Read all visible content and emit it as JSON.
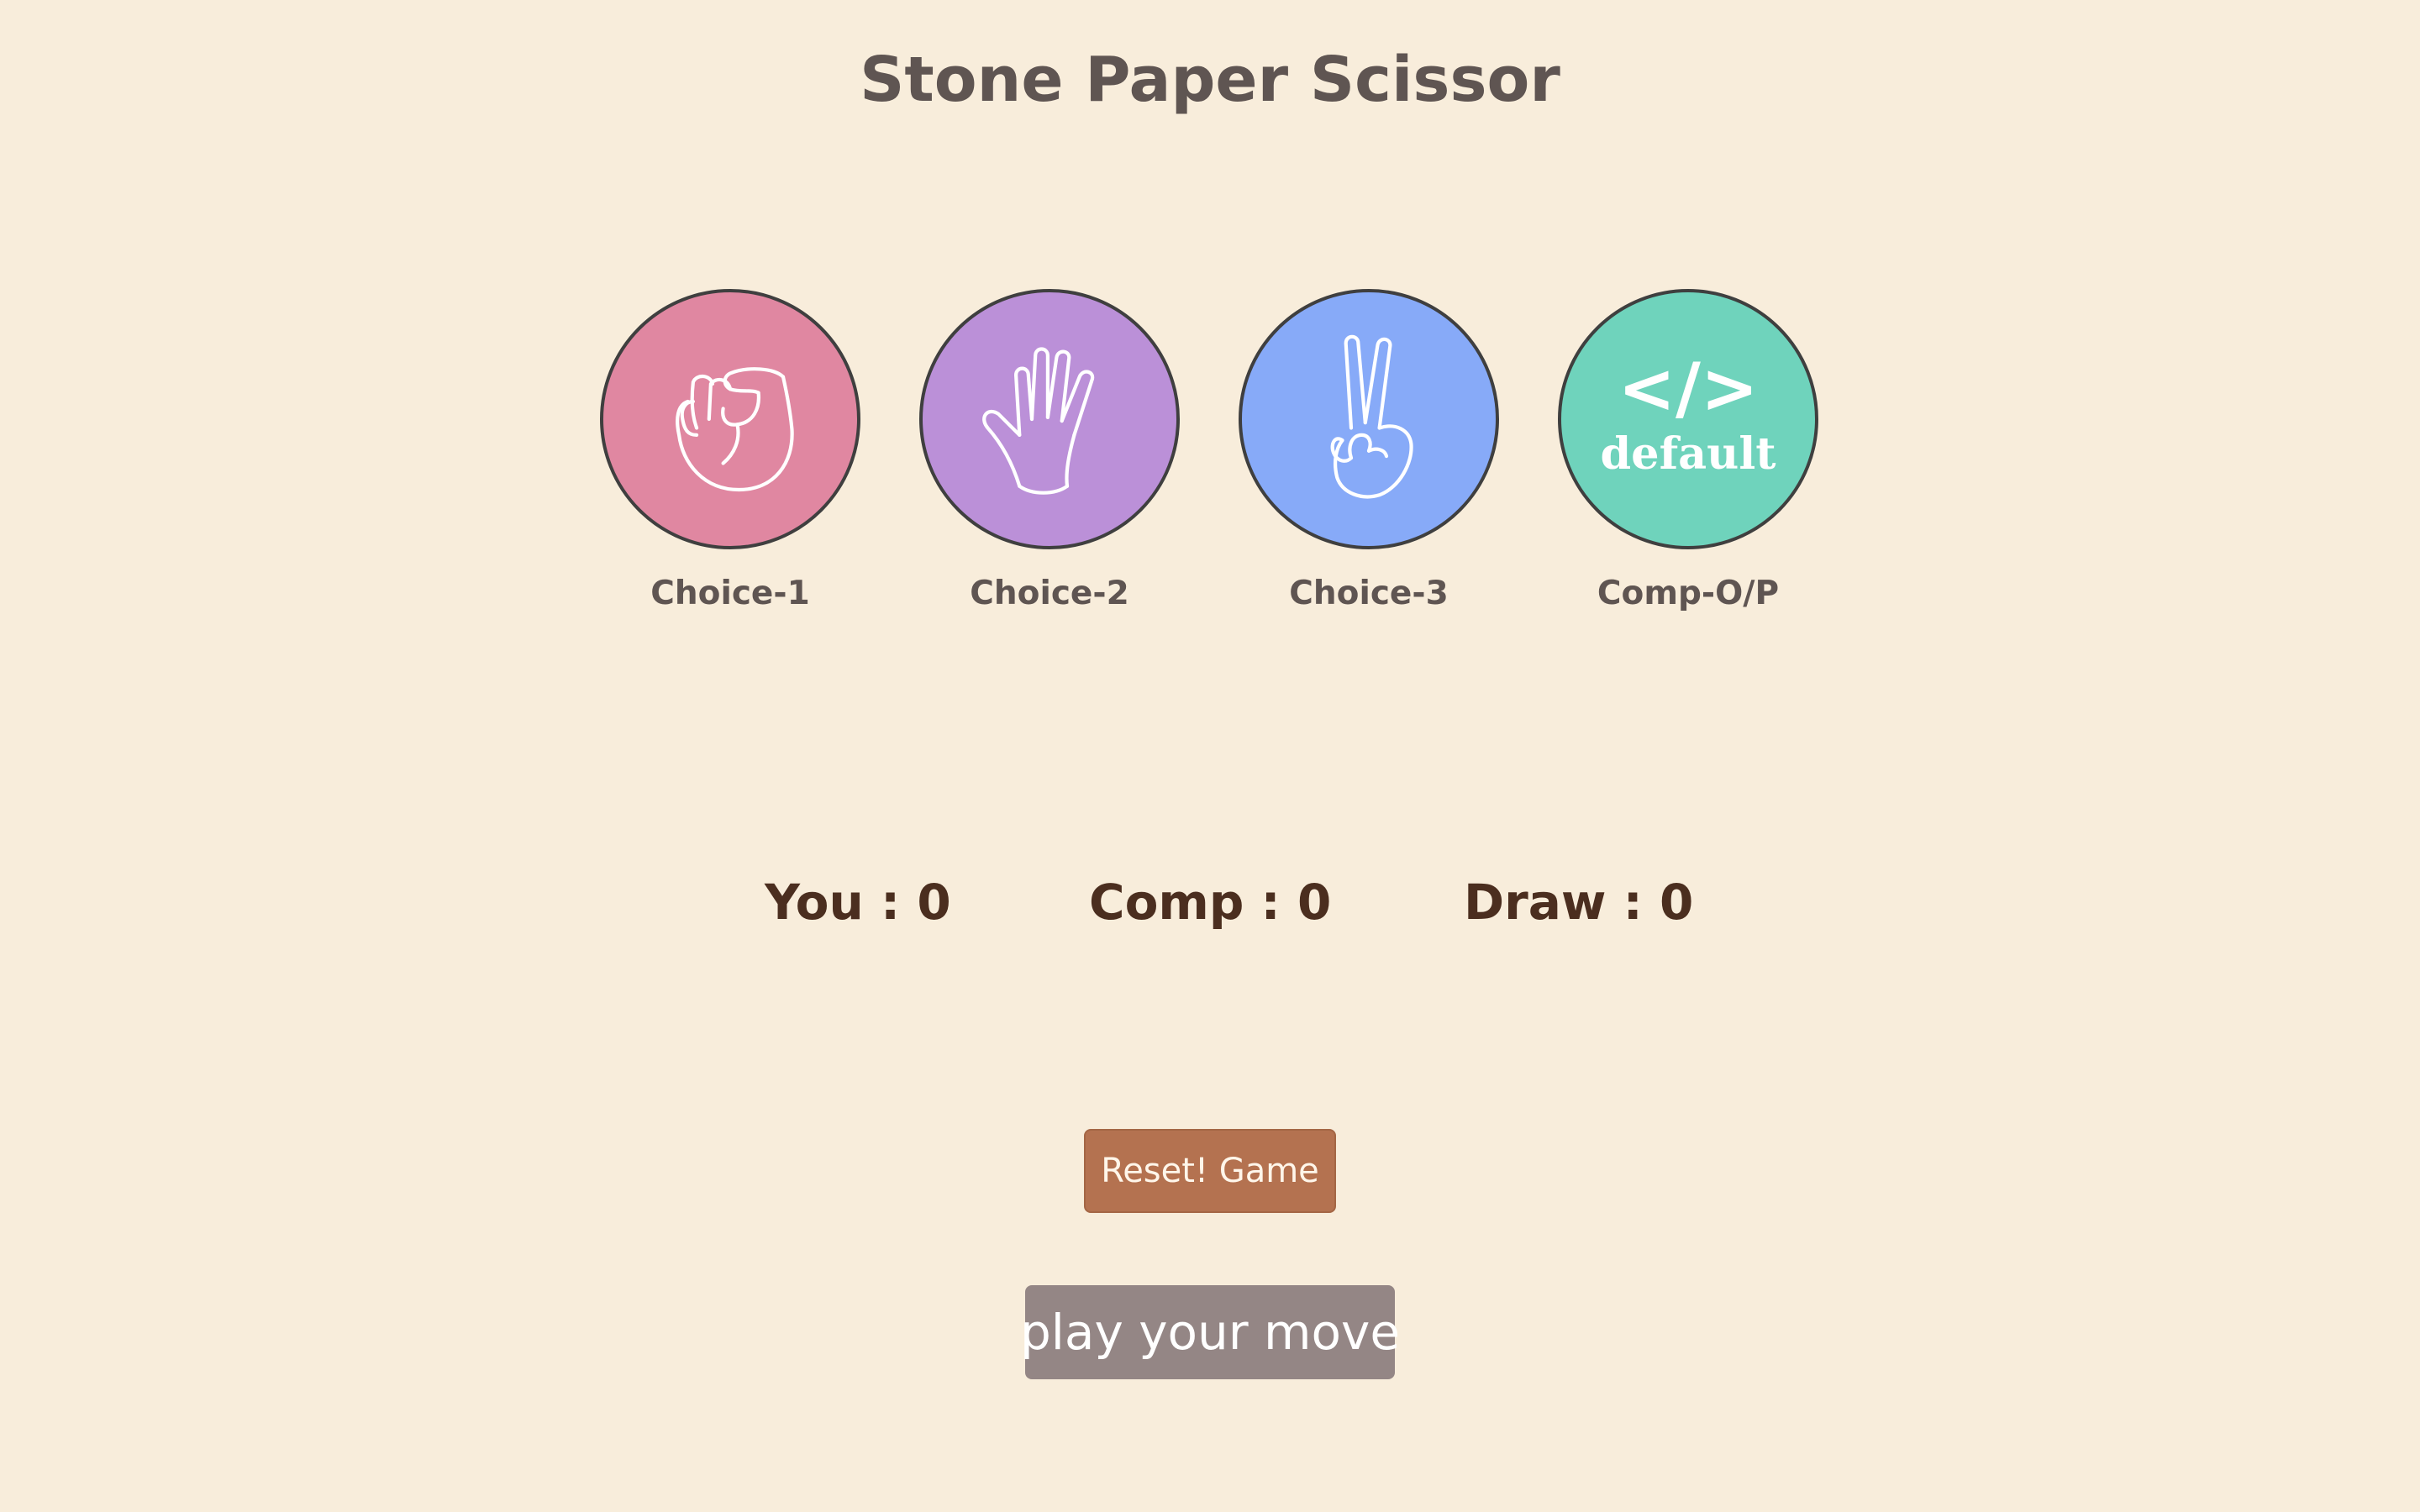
{
  "header": {
    "title": "Stone Paper Scissor"
  },
  "choices": [
    {
      "label": "Choice-1",
      "icon": "fist-icon",
      "color": "#e087a1"
    },
    {
      "label": "Choice-2",
      "icon": "open-hand-icon",
      "color": "#bb90d8"
    },
    {
      "label": "Choice-3",
      "icon": "peace-hand-icon",
      "color": "#87aaf8"
    },
    {
      "label": "Comp-O/P",
      "icon": "default-code-icon",
      "color": "#6fd3bc",
      "icon_text": {
        "symbol": "</>",
        "word": "default"
      }
    }
  ],
  "scores": {
    "you": "You : 0",
    "comp": "Comp : 0",
    "draw": "Draw : 0"
  },
  "controls": {
    "reset_label": "Reset! Game"
  },
  "message": {
    "text": "play your move",
    "bg": "#948685"
  },
  "colors": {
    "background": "#f8eddb",
    "title": "#5f5552",
    "score": "#4b2e1f",
    "reset": "#b47250"
  }
}
